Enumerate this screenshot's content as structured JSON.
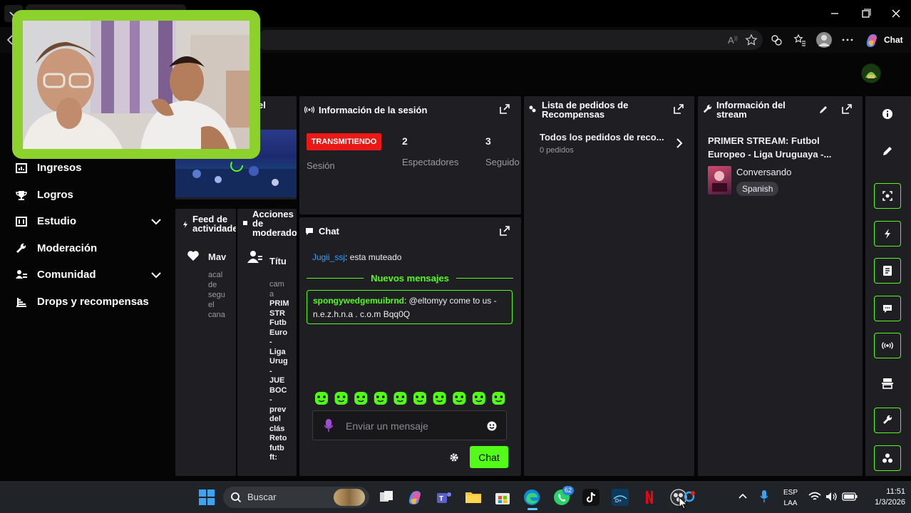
{
  "browser": {
    "copilot_label": "Chat",
    "tab_title": ""
  },
  "sidebar": {
    "items": [
      {
        "label": "Ingresos",
        "icon": "chart-bar-icon",
        "expand": false
      },
      {
        "label": "Logros",
        "icon": "trophy-icon",
        "expand": false
      },
      {
        "label": "Estudio",
        "icon": "studio-icon",
        "expand": true
      },
      {
        "label": "Moderación",
        "icon": "wrench-icon",
        "expand": false
      },
      {
        "label": "Comunidad",
        "icon": "community-icon",
        "expand": true
      },
      {
        "label": "Drops y recompensas",
        "icon": "gift-icon",
        "expand": false
      }
    ]
  },
  "preview_panel": {
    "title_partial": "el"
  },
  "feed_panel": {
    "title": "Feed de actividades",
    "item_name": "Mav",
    "item_text": [
      "acal",
      "de",
      "segu",
      "el",
      "cana"
    ]
  },
  "mod_panel": {
    "title": "Acciones de moderador",
    "item_title": "Títu",
    "item_text": [
      "cam",
      "a",
      "PRIM",
      "STR",
      "Futb",
      "Euro",
      "-",
      "Liga",
      "Urug",
      "-",
      "JUE",
      "BOC",
      "-",
      "prev",
      "del",
      "clás",
      "Reto",
      "futb",
      "ft:"
    ]
  },
  "session": {
    "title": "Información de la sesión",
    "badge": "TRANSMITIENDO",
    "badge_caption": "Sesión",
    "viewers_value": "2",
    "viewers_label": "Espectadores",
    "followers_value": "3",
    "followers_label": "Seguido"
  },
  "rewards": {
    "title": "Lista de pedidos de Recompensas",
    "row_title": "Todos los pedidos de reco...",
    "row_sub": "0 pedidos"
  },
  "stream_info": {
    "title": "Información del stream",
    "stream_title": "PRIMER STREAM: Futbol Europeo - Liga Uruguaya -...",
    "category": "Conversando",
    "language": "Spanish"
  },
  "chat": {
    "title": "Chat",
    "msg1_user": "Jugii_ssj",
    "msg1_text": ": esta muteado",
    "divider": "Nuevos mensajes",
    "msg2_user": "spongywedgemuibrnd",
    "msg2_text": ": @eltomyy come to us - n.e.z.h.n.a . c.o.m Bqq0Q",
    "input_placeholder": "Enviar un mensaje",
    "send_label": "Chat"
  },
  "colors": {
    "accent": "#53fc18",
    "live_red": "#e91916",
    "panel": "#1f1f23",
    "cam_border": "#8dd12d"
  },
  "taskbar": {
    "search_label": "Buscar",
    "whatsapp_badge": "62",
    "lang_top": "ESP",
    "lang_bottom": "LAA",
    "time": "11:51",
    "date": "1/3/2026"
  }
}
